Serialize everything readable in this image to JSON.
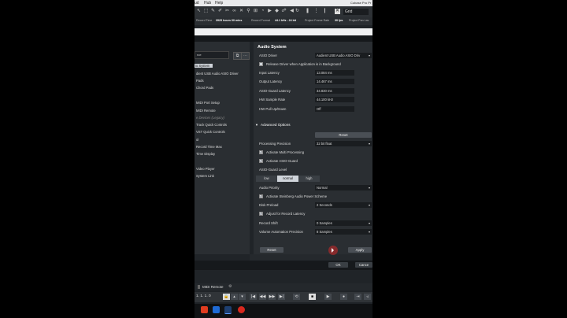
{
  "menubar": {
    "items": [
      "ud",
      "Hub",
      "Help"
    ],
    "window_title": "Cubase Pro Pr"
  },
  "toolbar": {
    "grid_label": "Grid"
  },
  "statusbar": {
    "record_time_label": "Record Time",
    "record_time_value": "3925 hours 00 mins",
    "record_format_label": "Record Format",
    "record_format_value": "44.1 kHz - 24 bit",
    "frame_rate_label": "Project Frame Rate",
    "frame_rate_value": "30 fps",
    "pan_label": "Project Pan Lav"
  },
  "left_pane": {
    "select_value": "rce",
    "items": [
      {
        "label": "io System",
        "selected": true
      },
      {
        "label": "dient USB Audio ASIO Driver"
      },
      {
        "label": "Pads"
      },
      {
        "label": "Chord Pads"
      },
      {
        "label": "MIDI Port Setup"
      },
      {
        "label": "MIDI Remote"
      },
      {
        "label": "e Devices (Legacy)",
        "dim": true
      },
      {
        "label": "Track Quick Controls"
      },
      {
        "label": "VST Quick Controls"
      },
      {
        "label": "ol"
      },
      {
        "label": "Record Time Max"
      },
      {
        "label": "Time Display"
      },
      {
        "label": "Video Player"
      },
      {
        "label": "System Link"
      }
    ]
  },
  "panel": {
    "title": "Audio System",
    "asio_driver_label": "ASIO Driver",
    "asio_driver_value": "Audient USB Audio ASIO Driv",
    "release_driver_label": "Release Driver when Application is in Background",
    "input_latency_label": "Input Latency",
    "input_latency_value": "13.084 ms",
    "output_latency_label": "Output Latency",
    "output_latency_value": "14.467 ms",
    "asio_guard_latency_label": "ASIO-Guard Latency",
    "asio_guard_latency_value": "34.830 ms",
    "hw_sample_rate_label": "HW Sample Rate",
    "hw_sample_rate_value": "44.100 kHz",
    "hw_pull_label": "HW Pull Up/Down",
    "hw_pull_value": "Off",
    "advanced_title": "Advanced Options",
    "reset_label": "Reset",
    "processing_precision_label": "Processing Precision",
    "processing_precision_value": "32 bit float",
    "multi_processing_label": "Activate Multi Processing",
    "asio_guard_label": "Activate ASIO-Guard",
    "asio_guard_level_label": "ASIO-Guard Level",
    "levels": [
      "low",
      "normal",
      "high"
    ],
    "audio_priority_label": "Audio Priority",
    "audio_priority_value": "Normal",
    "steinberg_power_label": "Activate Steinberg Audio Power Scheme",
    "disk_preload_label": "Disk Preload",
    "disk_preload_value": "2 Seconds",
    "adjust_record_label": "Adjust for Record Latency",
    "record_shift_label": "Record Shift",
    "record_shift_value": "0 Samples",
    "volume_precision_label": "Volume Automation Precision",
    "volume_precision_value": "8 Samples",
    "footer_reset_label": "Reset",
    "apply_label": "Apply"
  },
  "dialog": {
    "ok_label": "OK",
    "cancel_label": "Cance"
  },
  "bottom": {
    "midi_remote_label": "MIDI Remote",
    "position_value": "1. 1. 1. 0"
  }
}
